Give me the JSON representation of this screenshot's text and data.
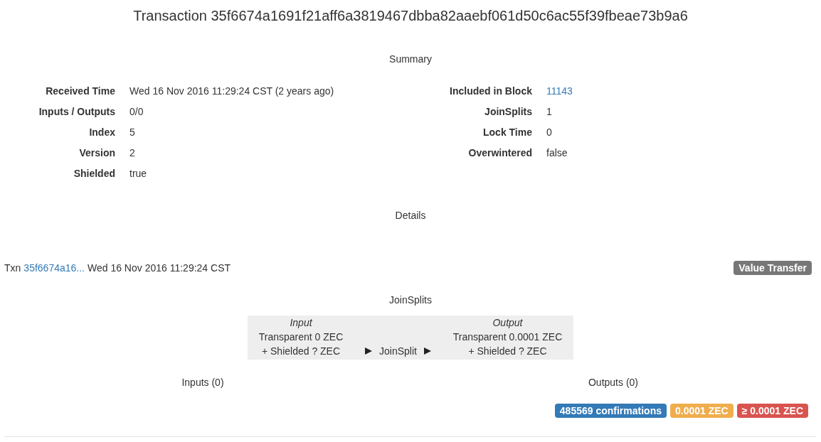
{
  "title": "Transaction 35f6674a1691f21aff6a3819467dbba82aaebf061d50c6ac55f39fbeae73b9a6",
  "summary": {
    "heading": "Summary",
    "left": [
      {
        "label": "Received Time",
        "value": "Wed 16 Nov 2016 11:29:24 CST (2 years ago)",
        "link": false
      },
      {
        "label": "Inputs / Outputs",
        "value": "0/0",
        "link": false
      },
      {
        "label": "Index",
        "value": "5",
        "link": false
      },
      {
        "label": "Version",
        "value": "2",
        "link": false
      },
      {
        "label": "Shielded",
        "value": "true",
        "link": false
      }
    ],
    "right": [
      {
        "label": "Included in Block",
        "value": "11143",
        "link": true
      },
      {
        "label": "JoinSplits",
        "value": "1",
        "link": false
      },
      {
        "label": "Lock Time",
        "value": "0",
        "link": false
      },
      {
        "label": "Overwintered",
        "value": "false",
        "link": false
      }
    ]
  },
  "details": {
    "heading": "Details",
    "txn": {
      "prefix": "Txn",
      "hash": "35f6674a16...",
      "time": "Wed 16 Nov 2016 11:29:24 CST"
    },
    "type_badge": {
      "text": "Value Transfer",
      "color": "#777777"
    },
    "joinsplits": {
      "heading": "JoinSplits",
      "input": {
        "heading": "Input",
        "lines": [
          "Transparent 0 ZEC",
          "+ Shielded ? ZEC"
        ]
      },
      "label": "JoinSplit",
      "output": {
        "heading": "Output",
        "lines": [
          "Transparent 0.0001 ZEC",
          "+ Shielded ? ZEC"
        ]
      }
    },
    "inputs_heading": "Inputs (0)",
    "outputs_heading": "Outputs (0)",
    "badges": [
      {
        "text": "485569 confirmations",
        "color": "#337ab7"
      },
      {
        "text": "0.0001 ZEC",
        "color": "#f0ad4e"
      },
      {
        "text": "≥ 0.0001 ZEC",
        "color": "#d9534f"
      }
    ]
  }
}
